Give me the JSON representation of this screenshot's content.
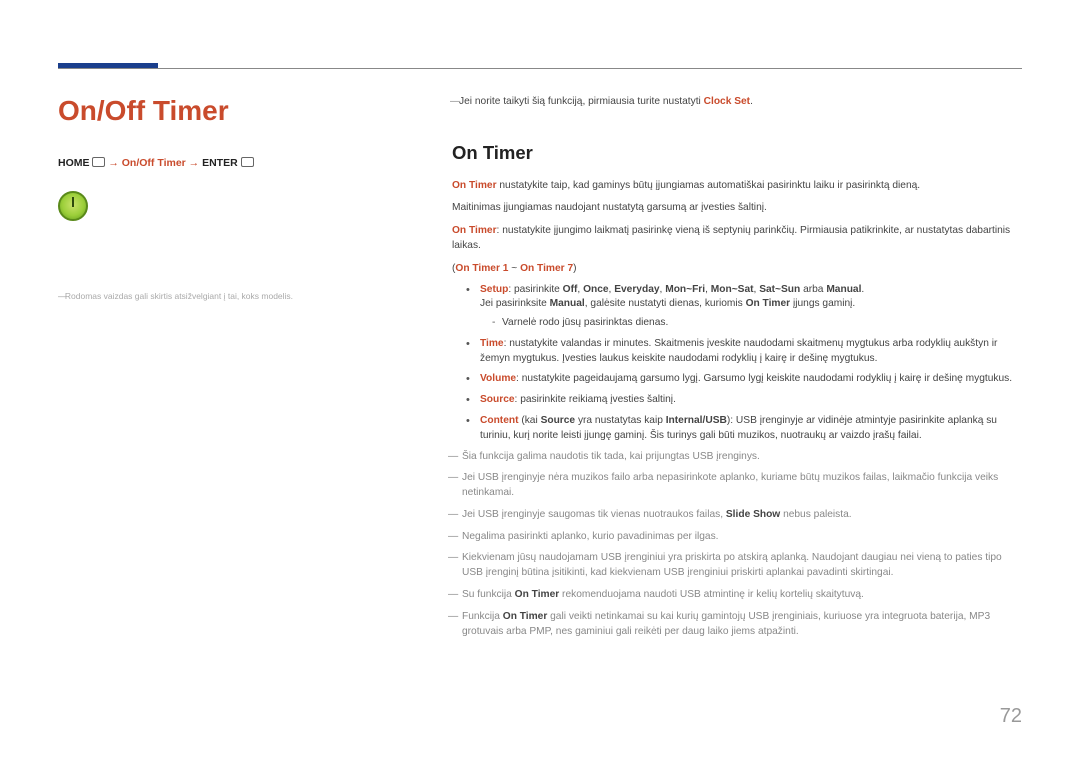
{
  "page_number": "72",
  "title": "On/Off Timer",
  "breadcrumb": {
    "home": "HOME",
    "middle": "On/Off Timer",
    "enter": "ENTER",
    "arrow": " → "
  },
  "left_disclaimer": "Rodomas vaizdas gali skirtis atsižvelgiant į tai, koks modelis.",
  "pre_note_a": "Jei norite taikyti šią funkciją, pirmiausia turite nustatyti ",
  "pre_note_b": "Clock Set",
  "pre_note_c": ".",
  "section_heading": "On Timer",
  "intro1_a": "On Timer",
  "intro1_b": " nustatykite taip, kad gaminys būtų įjungiamas automatiškai pasirinktu laiku ir pasirinktą dieną.",
  "intro2": "Maitinimas įjungiamas naudojant nustatytą garsumą ar įvesties šaltinį.",
  "intro3_a": "On Timer",
  "intro3_b": ": nustatykite įjungimo laikmatį pasirinkę vieną iš septynių parinkčių. Pirmiausia patikrinkite, ar nustatytas dabartinis laikas.",
  "range": {
    "pre": "(",
    "a": "On Timer 1",
    "mid": " ~ ",
    "b": "On Timer 7",
    "post": ")"
  },
  "bullets": {
    "setup": {
      "label": "Setup",
      "text1": ": pasirinkite ",
      "off": "Off",
      "c1": ", ",
      "once": "Once",
      "c2": ", ",
      "ev": "Everyday",
      "c3": ", ",
      "mf": "Mon~Fri",
      "c4": ", ",
      "ms": "Mon~Sat",
      "c5": ", ",
      "ss": "Sat~Sun",
      "or": " arba ",
      "man": "Manual",
      "dot": ".",
      "line2a": "Jei pasirinksite ",
      "line2b": "Manual",
      "line2c": ", galėsite nustatyti dienas, kuriomis ",
      "line2d": "On Timer",
      "line2e": " įjungs gaminį.",
      "sub": "Varnelė rodo jūsų pasirinktas dienas."
    },
    "time": {
      "label": "Time",
      "text": ": nustatykite valandas ir minutes. Skaitmenis įveskite naudodami skaitmenų mygtukus arba rodyklių aukštyn ir žemyn mygtukus. Įvesties laukus keiskite naudodami rodyklių į kairę ir dešinę mygtukus."
    },
    "volume": {
      "label": "Volume",
      "text": ": nustatykite pageidaujamą garsumo lygį. Garsumo lygį keiskite naudodami rodyklių į kairę ir dešinę mygtukus."
    },
    "source": {
      "label": "Source",
      "text": ": pasirinkite reikiamą įvesties šaltinį."
    },
    "content": {
      "label": "Content",
      "text1": " (kai ",
      "src": "Source",
      "text2": " yra nustatytas kaip ",
      "iu": "Internal/USB",
      "text3": "): USB įrenginyje ar vidinėje atmintyje pasirinkite aplanką su turiniu, kurį norite leisti įjungę gaminį. Šis turinys gali būti muzikos, nuotraukų ar vaizdo įrašų failai."
    }
  },
  "notes": {
    "n1": "Šia funkcija galima naudotis tik tada, kai prijungtas USB įrenginys.",
    "n2": "Jei USB įrenginyje nėra muzikos failo arba nepasirinkote aplanko, kuriame būtų muzikos failas, laikmačio funkcija veiks netinkamai.",
    "n3a": "Jei USB įrenginyje saugomas tik vienas nuotraukos failas, ",
    "n3b": "Slide Show",
    "n3c": " nebus paleista.",
    "n4": "Negalima pasirinkti aplanko, kurio pavadinimas per ilgas.",
    "n5": "Kiekvienam jūsų naudojamam USB įrenginiui yra priskirta po atskirą aplanką. Naudojant daugiau nei vieną to paties tipo USB įrenginį būtina įsitikinti, kad kiekvienam USB įrenginiui priskirti aplankai pavadinti skirtingai.",
    "n6a": "Su funkcija ",
    "n6b": "On Timer",
    "n6c": " rekomenduojama naudoti USB atmintinę ir kelių kortelių skaitytuvą.",
    "n7a": "Funkcija ",
    "n7b": "On Timer",
    "n7c": " gali veikti netinkamai su kai kurių gamintojų USB įrenginiais, kuriuose yra integruota baterija, MP3 grotuvais arba PMP, nes gaminiui gali reikėti per daug laiko jiems atpažinti."
  }
}
